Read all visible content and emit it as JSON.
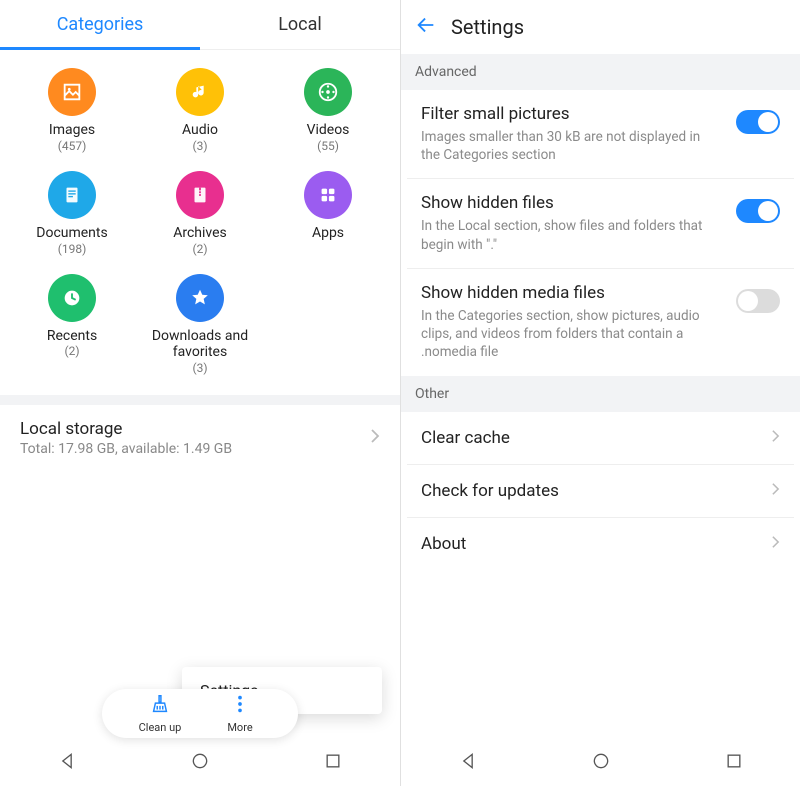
{
  "left": {
    "tabs": {
      "categories": "Categories",
      "local": "Local"
    },
    "cats": [
      {
        "name": "Images",
        "count": "(457)",
        "color": "#ff8a1f",
        "icon": "image"
      },
      {
        "name": "Audio",
        "count": "(3)",
        "color": "#ffc107",
        "icon": "music"
      },
      {
        "name": "Videos",
        "count": "(55)",
        "color": "#2bb559",
        "icon": "video"
      },
      {
        "name": "Documents",
        "count": "(198)",
        "color": "#1fa8e8",
        "icon": "doc"
      },
      {
        "name": "Archives",
        "count": "(2)",
        "color": "#e82f8f",
        "icon": "zip"
      },
      {
        "name": "Apps",
        "count": "",
        "color": "#9b5cf0",
        "icon": "apps"
      },
      {
        "name": "Recents",
        "count": "(2)",
        "color": "#1fbf6e",
        "icon": "clock"
      },
      {
        "name": "Downloads and favorites",
        "count": "(3)",
        "color": "#2a7df0",
        "icon": "star"
      }
    ],
    "storage": {
      "title": "Local storage",
      "sub": "Total: 17.98 GB, available: 1.49 GB"
    },
    "popup": "Settings",
    "toolbar": {
      "cleanup": "Clean up",
      "more": "More"
    }
  },
  "right": {
    "title": "Settings",
    "sections": {
      "advanced": "Advanced",
      "other": "Other"
    },
    "items": [
      {
        "title": "Filter small pictures",
        "desc": "Images smaller than 30 kB are not displayed in the Categories section",
        "on": true
      },
      {
        "title": "Show hidden files",
        "desc": "In the Local section, show files and folders that begin with \".\"",
        "on": true
      },
      {
        "title": "Show hidden media files",
        "desc": "In the Categories section, show pictures, audio clips, and videos from folders that contain a .nomedia file",
        "on": false
      }
    ],
    "links": [
      {
        "label": "Clear cache"
      },
      {
        "label": "Check for updates"
      },
      {
        "label": "About"
      }
    ]
  }
}
